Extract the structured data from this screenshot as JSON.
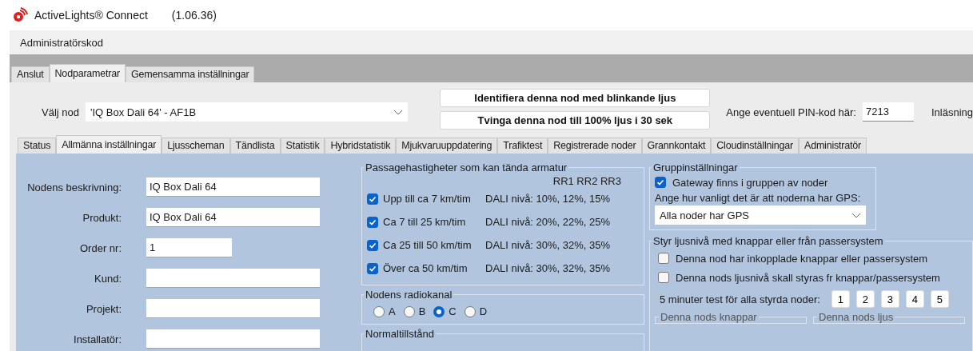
{
  "window": {
    "title": "ActiveLights® Connect",
    "version": "(1.06.36)"
  },
  "menu": [
    "Administratörskod"
  ],
  "main_tabs": [
    {
      "label": "Anslut",
      "selected": false
    },
    {
      "label": "Nodparametrar",
      "selected": true
    },
    {
      "label": "Gemensamma inställningar",
      "selected": false
    }
  ],
  "node_select": {
    "label": "Välj nod",
    "value": "'IQ Box Dali 64' - AF1B"
  },
  "action_buttons": [
    "Identifiera denna nod med blinkande ljus",
    "Tvinga denna nod till 100% ljus i 30 sek"
  ],
  "pin": {
    "label": "Ange eventuell PIN-kod här:",
    "value": "7213"
  },
  "load_label": "Inläsning",
  "sub_tabs": [
    {
      "label": "Status",
      "selected": false
    },
    {
      "label": "Allmänna inställningar",
      "selected": true
    },
    {
      "label": "Ljusscheman",
      "selected": false
    },
    {
      "label": "Tändlista",
      "selected": false
    },
    {
      "label": "Statistik",
      "selected": false
    },
    {
      "label": "Hybridstatistik",
      "selected": false
    },
    {
      "label": "Mjukvaruuppdatering",
      "selected": false
    },
    {
      "label": "Trafiktest",
      "selected": false
    },
    {
      "label": "Registrerade noder",
      "selected": false
    },
    {
      "label": "Grannkontakt",
      "selected": false
    },
    {
      "label": "Cloudinställningar",
      "selected": false
    },
    {
      "label": "Administratör",
      "selected": false
    }
  ],
  "fields": [
    {
      "label": "Nodens beskrivning:",
      "value": "IQ Box Dali 64",
      "kind": "wide"
    },
    {
      "label": "Produkt:",
      "value": "IQ Box Dali 64",
      "kind": "wide"
    },
    {
      "label": "Order nr:",
      "value": "1",
      "kind": "narrow"
    },
    {
      "label": "Kund:",
      "kind": "wide"
    },
    {
      "label": "Projekt:",
      "kind": "wide"
    },
    {
      "label": "Installatör:",
      "kind": "wide"
    }
  ],
  "speed_group": {
    "title": "Passagehastigheter som kan tända armatur",
    "header": "RR1 RR2 RR3",
    "rows": [
      {
        "label": "Upp till ca 7 km/tim",
        "checked": true,
        "levels": "DALI nivå: 10%, 12%, 15%"
      },
      {
        "label": "Ca 7 till 25 km/tim",
        "checked": true,
        "levels": "DALI nivå: 20%, 22%, 25%"
      },
      {
        "label": "Ca 25 till 50 km/tim",
        "checked": true,
        "levels": "DALI nivå: 30%, 32%, 35%"
      },
      {
        "label": "Över ca 50 km/tim",
        "checked": true,
        "levels": "DALI nivå: 30%, 32%, 35%"
      }
    ]
  },
  "radio_group": {
    "title": "Nodens radiokanal",
    "options": [
      {
        "label": "A",
        "selected": false
      },
      {
        "label": "B",
        "selected": false
      },
      {
        "label": "C",
        "selected": true
      },
      {
        "label": "D",
        "selected": false
      }
    ]
  },
  "normal_group": {
    "title": "Normaltillstånd"
  },
  "group_settings": {
    "title": "Gruppinställningar",
    "gateway": {
      "label": "Gateway finns i gruppen av noder",
      "checked": true
    },
    "gps_label": "Ange hur vanligt det är att noderna har GPS:",
    "gps_value": "Alla noder har GPS"
  },
  "control_group": {
    "title": "Styr ljusnivå med knappar eller från passersystem",
    "options": [
      {
        "label": "Denna nod har inkopplade knappar eller passersystem",
        "checked": false
      },
      {
        "label": "Denna nods ljusnivå skall styras fr knappar/passersystem",
        "checked": false
      }
    ],
    "test_label": "5 minuter test för alla styrda noder:",
    "test_buttons": [
      "1",
      "2",
      "3",
      "4",
      "5"
    ],
    "subgroups": [
      "Denna nods knappar",
      "Denna nods ljus"
    ]
  }
}
